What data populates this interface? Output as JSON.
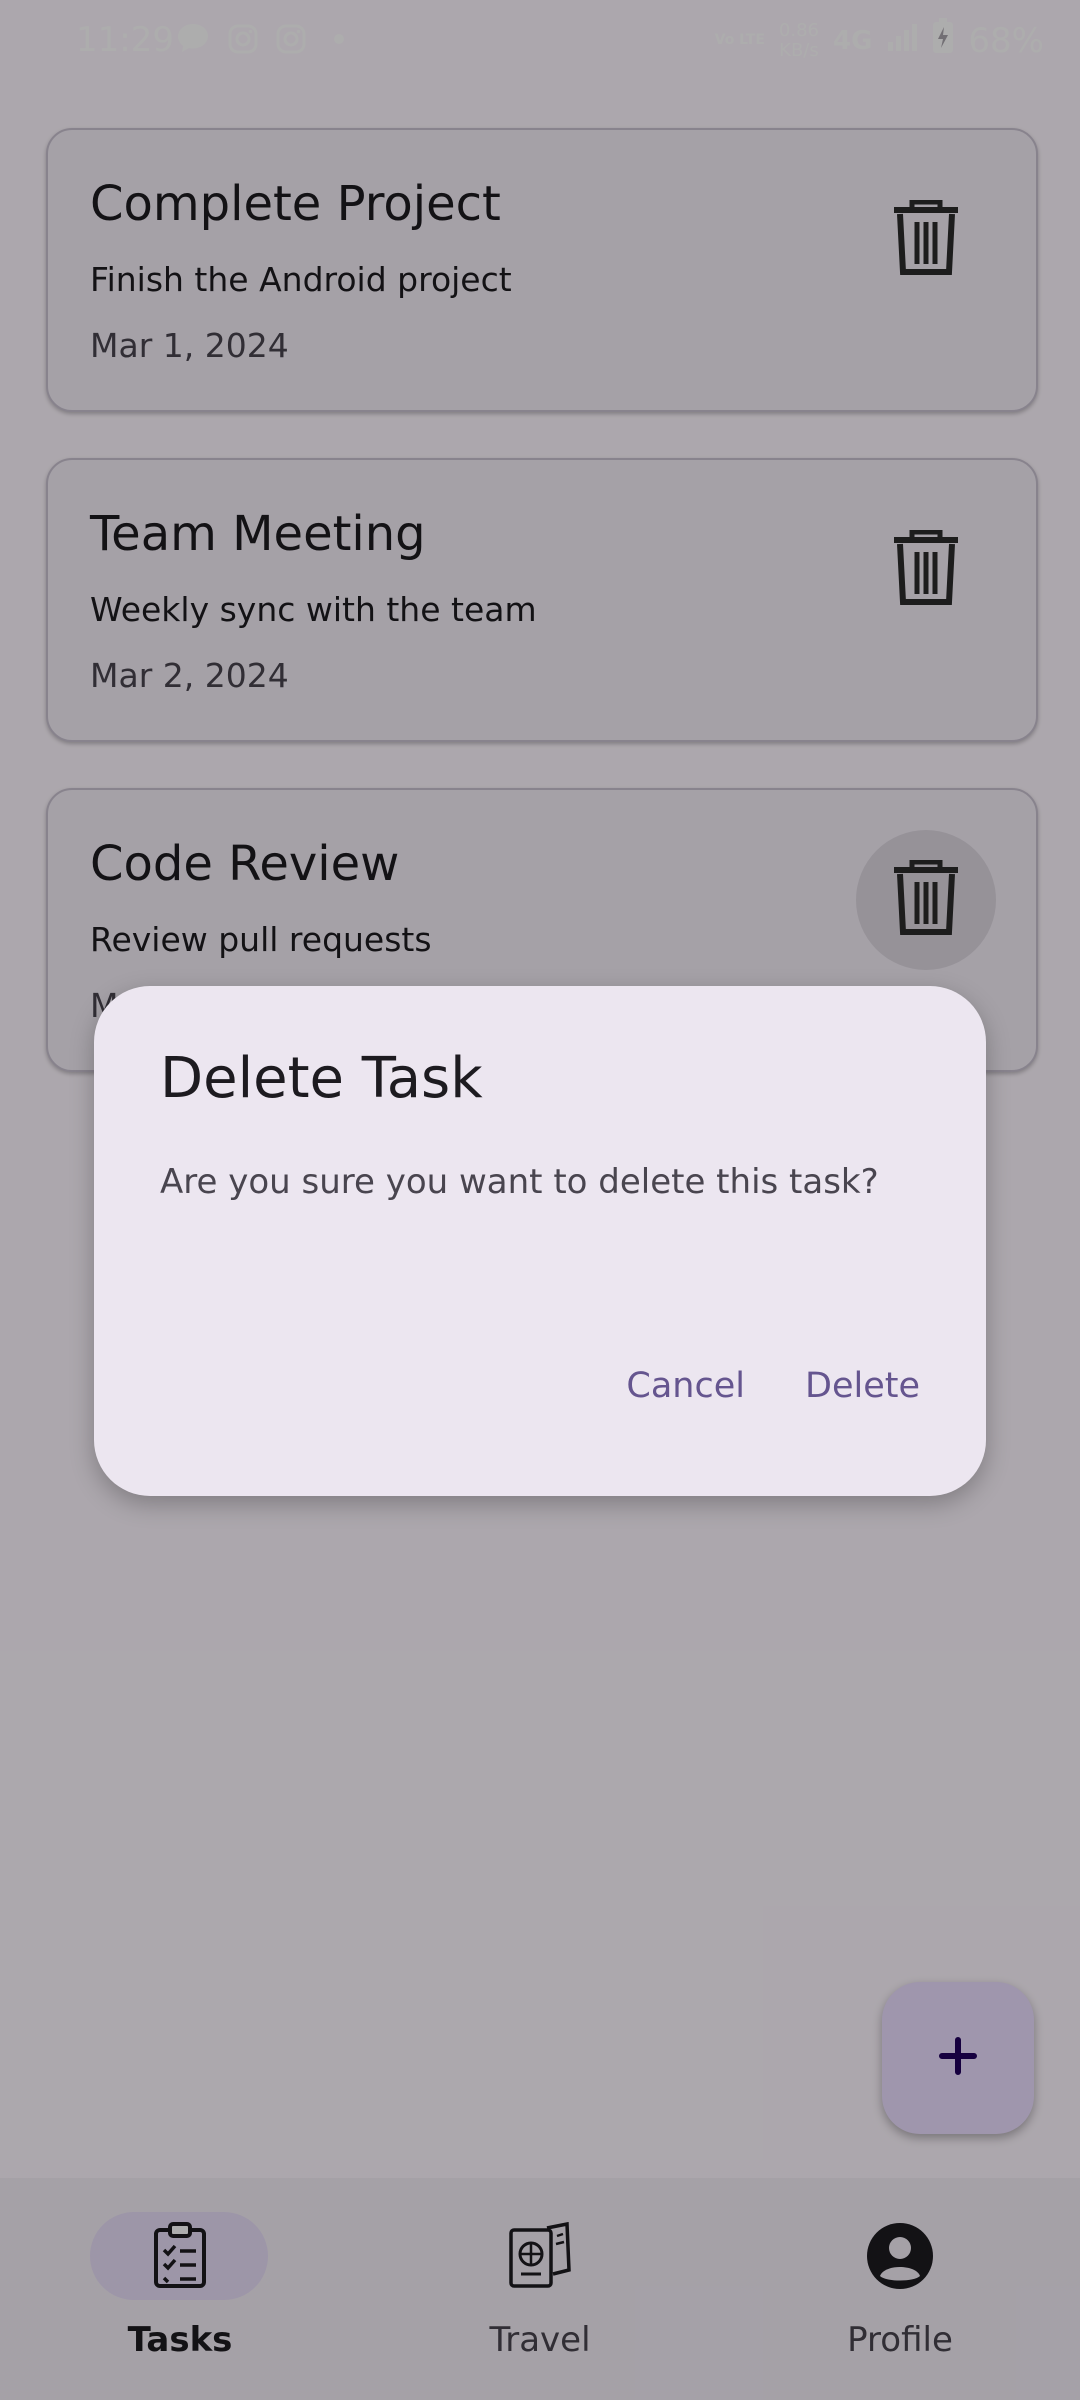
{
  "status_bar": {
    "time": "11:29",
    "notification_icons": [
      "chat-bubble-icon",
      "instagram-icon",
      "instagram-icon",
      "dot-icon"
    ],
    "volte": "Vo LTE",
    "net_speed_value": "0.86",
    "net_speed_unit": "KB/s",
    "network": "4G",
    "battery": "68%"
  },
  "tasks": [
    {
      "title": "Complete Project",
      "description": "Finish the Android project",
      "date": "Mar 1, 2024"
    },
    {
      "title": "Team Meeting",
      "description": "Weekly sync with the team",
      "date": "Mar 2, 2024"
    },
    {
      "title": "Code Review",
      "description": "Review pull requests",
      "date": "M"
    }
  ],
  "dialog": {
    "title": "Delete Task",
    "message": "Are you sure you want to delete this task?",
    "cancel_label": "Cancel",
    "confirm_label": "Delete"
  },
  "fab": {
    "icon": "plus-icon"
  },
  "bottom_nav": {
    "items": [
      {
        "label": "Tasks",
        "icon": "clipboard-checklist-icon",
        "active": true
      },
      {
        "label": "Travel",
        "icon": "passport-ticket-icon",
        "active": false
      },
      {
        "label": "Profile",
        "icon": "account-circle-icon",
        "active": false
      }
    ]
  },
  "colors": {
    "accent": "#65558f",
    "surface": "#f3edf7",
    "dialog_surface": "#ece6f0",
    "fab": "#eaddff",
    "scrim": "rgba(0,0,0,0.32)"
  }
}
